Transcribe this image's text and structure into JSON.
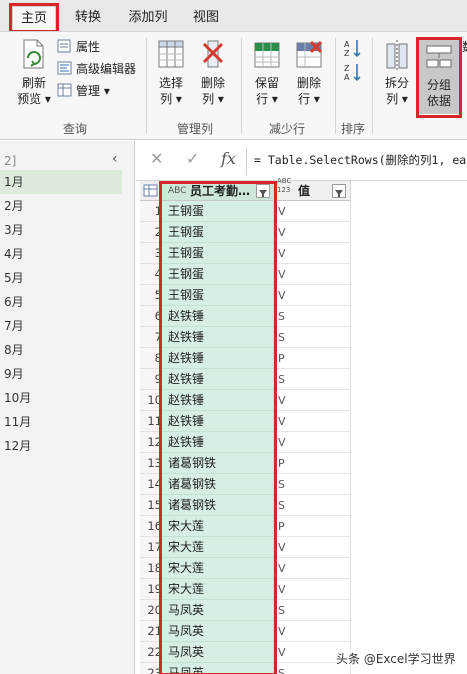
{
  "tabs": [
    "主页",
    "转换",
    "添加列",
    "视图"
  ],
  "ribbon": {
    "refresh_preview": [
      "刷新",
      "预览 ▾"
    ],
    "properties": "属性",
    "advanced_editor": "高级编辑器",
    "manage": "管理 ▾",
    "choose_columns": [
      "选择",
      "列 ▾"
    ],
    "remove_columns": [
      "删除",
      "列 ▾"
    ],
    "keep_rows": [
      "保留",
      "行 ▾"
    ],
    "remove_rows": [
      "删除",
      "行 ▾"
    ],
    "split_column": [
      "拆分",
      "列 ▾"
    ],
    "group_by": [
      "分组",
      "依据"
    ],
    "edge_label": "数",
    "groups": {
      "query": "查询",
      "manage_columns": "管理列",
      "reduce_rows": "减少行",
      "sort": "排序"
    }
  },
  "queries": [
    "2]",
    "1月",
    "2月",
    "3月",
    "4月",
    "5月",
    "6月",
    "7月",
    "8月",
    "9月",
    "10月",
    "11月",
    "12月"
  ],
  "formula_bar": {
    "cancel": "✕",
    "confirm": "✓",
    "fx": "fx",
    "formula": "= Table.SelectRows(删除的列1, ea"
  },
  "table": {
    "columns": [
      {
        "type_icon": "ABC",
        "name": "员工考勤…"
      },
      {
        "type_icon": "ABC 123",
        "name": "值"
      }
    ],
    "rows": [
      {
        "n": "1",
        "name": "王钢蛋",
        "value": "V"
      },
      {
        "n": "2",
        "name": "王钢蛋",
        "value": "V"
      },
      {
        "n": "3",
        "name": "王钢蛋",
        "value": "V"
      },
      {
        "n": "4",
        "name": "王钢蛋",
        "value": "V"
      },
      {
        "n": "5",
        "name": "王钢蛋",
        "value": "V"
      },
      {
        "n": "6",
        "name": "赵铁锤",
        "value": "S"
      },
      {
        "n": "7",
        "name": "赵铁锤",
        "value": "S"
      },
      {
        "n": "8",
        "name": "赵铁锤",
        "value": "P"
      },
      {
        "n": "9",
        "name": "赵铁锤",
        "value": "S"
      },
      {
        "n": "10",
        "name": "赵铁锤",
        "value": "V"
      },
      {
        "n": "11",
        "name": "赵铁锤",
        "value": "V"
      },
      {
        "n": "12",
        "name": "赵铁锤",
        "value": "V"
      },
      {
        "n": "13",
        "name": "诸葛钢铁",
        "value": "P"
      },
      {
        "n": "14",
        "name": "诸葛钢铁",
        "value": "S"
      },
      {
        "n": "15",
        "name": "诸葛钢铁",
        "value": "S"
      },
      {
        "n": "16",
        "name": "宋大莲",
        "value": "P"
      },
      {
        "n": "17",
        "name": "宋大莲",
        "value": "V"
      },
      {
        "n": "18",
        "name": "宋大莲",
        "value": "V"
      },
      {
        "n": "19",
        "name": "宋大莲",
        "value": "V"
      },
      {
        "n": "20",
        "name": "马凤英",
        "value": "S"
      },
      {
        "n": "21",
        "name": "马凤英",
        "value": "V"
      },
      {
        "n": "22",
        "name": "马凤英",
        "value": "V"
      },
      {
        "n": "23",
        "name": "马凤英",
        "value": "S"
      }
    ]
  },
  "watermark": "头条 @Excel学习世界",
  "colors": {
    "highlight": "#d9262a",
    "selected_column": "#d7efe2",
    "ribbon_bg": "#f7f7f7"
  }
}
